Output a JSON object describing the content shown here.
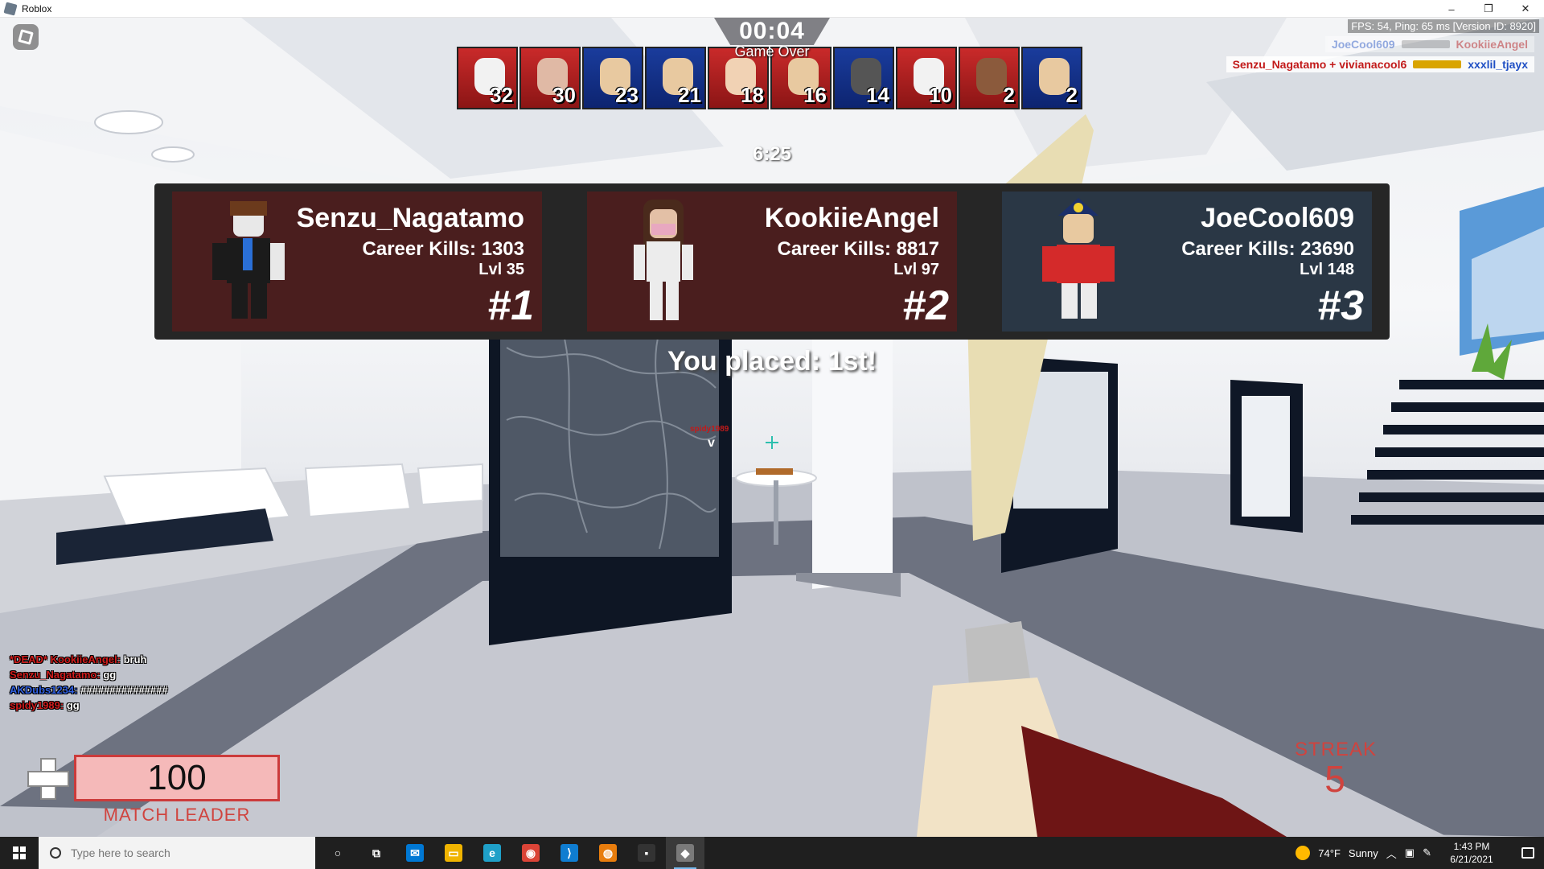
{
  "window": {
    "title": "Roblox",
    "controls": [
      "–",
      "❐",
      "✕"
    ]
  },
  "hud": {
    "match_timer": "00:04",
    "status": "Game Over",
    "round_timer": "6:25",
    "stats": "FPS: 54, Ping: 65 ms [Version ID: 8920]",
    "portraits": [
      {
        "score": "32",
        "team": "red",
        "skin": "#f2f2f2"
      },
      {
        "score": "30",
        "team": "red",
        "skin": "#e0b9a5"
      },
      {
        "score": "23",
        "team": "blue",
        "skin": "#e8c9a0"
      },
      {
        "score": "21",
        "team": "blue",
        "skin": "#e8c9a0"
      },
      {
        "score": "18",
        "team": "red",
        "skin": "#f1d2b4"
      },
      {
        "score": "16",
        "team": "red",
        "skin": "#e8c9a0"
      },
      {
        "score": "14",
        "team": "blue",
        "skin": "#555555"
      },
      {
        "score": "10",
        "team": "red",
        "skin": "#f2f2f2"
      },
      {
        "score": "2",
        "team": "red",
        "skin": "#8b5a3c"
      },
      {
        "score": "2",
        "team": "blue",
        "skin": "#e8c9a0"
      }
    ],
    "killfeed": [
      {
        "killer": "JoeCool609",
        "victim": "KookiieAngel",
        "killer_team": "blue",
        "victim_team": "red",
        "faded": true
      },
      {
        "killer": "Senzu_Nagatamo + vivianacool6",
        "victim": "xxxlil_tjayx",
        "killer_team": "red",
        "victim_team": "blue",
        "faded": false
      }
    ]
  },
  "results": {
    "cards": [
      {
        "name": "Senzu_Nagatamo",
        "kills": "Career Kills: 1303",
        "level": "Lvl 35",
        "rank": "#1",
        "style": "red"
      },
      {
        "name": "KookiieAngel",
        "kills": "Career Kills: 8817",
        "level": "Lvl 97",
        "rank": "#2",
        "style": "red"
      },
      {
        "name": "JoeCool609",
        "kills": "Career Kills: 23690",
        "level": "Lvl 148",
        "rank": "#3",
        "style": "slate"
      }
    ],
    "placement": "You placed: 1st!"
  },
  "world": {
    "player_tag": "spidy1989",
    "player_marker": "v"
  },
  "chat": [
    {
      "name": "*DEAD* KookiieAngel:",
      "message": "bruh",
      "team": "red"
    },
    {
      "name": "Senzu_Nagatamo:",
      "message": "gg",
      "team": "red"
    },
    {
      "name": "AKDubs1234:",
      "message": "###############",
      "team": "blue"
    },
    {
      "name": "spidy1989:",
      "message": "gg",
      "team": "red"
    }
  ],
  "player": {
    "health": "100",
    "health_fraction": 1.0,
    "title": "MATCH LEADER",
    "streak_label": "STREAK",
    "streak_value": "5"
  },
  "taskbar": {
    "search_placeholder": "Type here to search",
    "apps": [
      {
        "name": "cortana-icon",
        "glyph": "○",
        "color": "transparent"
      },
      {
        "name": "task-view-icon",
        "glyph": "⧉",
        "color": "transparent"
      },
      {
        "name": "mail-icon",
        "glyph": "✉",
        "color": "#0078d4"
      },
      {
        "name": "file-explorer-icon",
        "glyph": "▭",
        "color": "#f0b400"
      },
      {
        "name": "edge-icon",
        "glyph": "e",
        "color": "#1fa0c8"
      },
      {
        "name": "chrome-icon",
        "glyph": "◉",
        "color": "#db4437"
      },
      {
        "name": "vscode-icon",
        "glyph": "⟩",
        "color": "#0f7dd1"
      },
      {
        "name": "blender-icon",
        "glyph": "◍",
        "color": "#e87d0d"
      },
      {
        "name": "app-icon",
        "glyph": "▪",
        "color": "#333333"
      },
      {
        "name": "roblox-icon",
        "glyph": "◆",
        "color": "#7a7a7a"
      }
    ],
    "weather_temp": "74°F",
    "weather_text": "Sunny",
    "time": "1:43 PM",
    "date": "6/21/2021"
  },
  "colors": {
    "team_red": "#c21a1a",
    "team_blue": "#1f4fc4",
    "health_border": "#cc3b3b",
    "leader_text": "#d0433e"
  }
}
